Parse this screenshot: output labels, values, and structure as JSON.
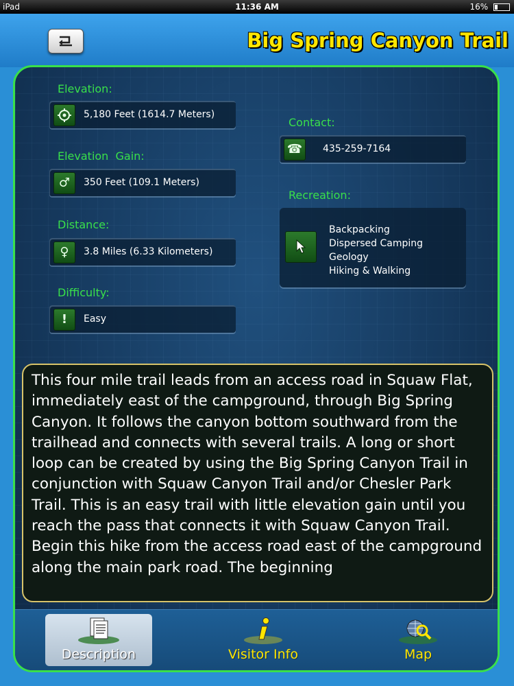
{
  "statusbar": {
    "device": "iPad",
    "time": "11:36 AM",
    "battery": "16%"
  },
  "header": {
    "title": "Big Spring Canyon Trail",
    "back_icon": "back-arrow-icon"
  },
  "fields": {
    "elevation": {
      "label": "Elevation:",
      "value": "5,180 Feet (1614.7 Meters)",
      "icon": "crosshair-icon"
    },
    "elevation_gain": {
      "label": "Elevation  Gain:",
      "value": "350 Feet (109.1 Meters)",
      "icon": "male-symbol-icon"
    },
    "distance": {
      "label": "Distance:",
      "value": "3.8 Miles (6.33 Kilometers)",
      "icon": "female-symbol-icon"
    },
    "difficulty": {
      "label": "Difficulty:",
      "value": "Easy",
      "icon": "exclamation-icon"
    },
    "contact": {
      "label": "Contact:",
      "value": "435-259-7164",
      "icon": "phone-icon"
    }
  },
  "recreation": {
    "label": "Recreation:",
    "items": [
      "Backpacking",
      "Dispersed Camping",
      "Geology",
      "Hiking & Walking"
    ],
    "icon": "cursor-icon"
  },
  "description": "This four mile trail leads from an access road in Squaw Flat, immediately east of the campground, through Big Spring Canyon. It follows the canyon bottom southward from the trailhead and connects with several trails. A long or short loop can be created by using the Big Spring Canyon Trail in conjunction with Squaw Canyon Trail and/or Chesler Park Trail. This is an easy trail with little elevation gain until you reach the pass that connects it with Squaw Canyon Trail. Begin this hike from the access road east of the campground along the main park road. The beginning",
  "tabs": [
    {
      "label": "Description",
      "icon": "document-icon",
      "active": true
    },
    {
      "label": "Visitor Info",
      "icon": "info-icon",
      "active": false
    },
    {
      "label": "Map",
      "icon": "globe-search-icon",
      "active": false
    }
  ],
  "colors": {
    "accent_green": "#39e04a",
    "title_yellow": "#ffe600",
    "border_gold": "#d8c46a"
  }
}
